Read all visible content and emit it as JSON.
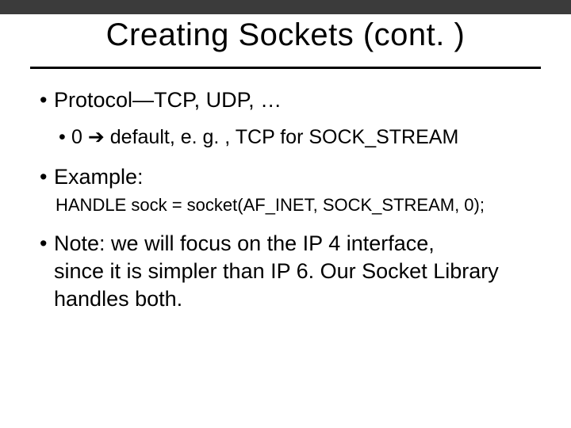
{
  "title": "Creating Sockets (cont. )",
  "bullets": {
    "protocol": "Protocol—TCP, UDP, …",
    "protocol_sub_zero": "0",
    "protocol_sub_arrow": "➔",
    "protocol_sub_text": " default, e. g. , TCP for SOCK_STREAM",
    "example": "Example:",
    "example_code": "HANDLE sock = socket(AF_INET, SOCK_STREAM, 0);",
    "note_label": "Note:",
    "note_text_first": " we will focus on the IP 4 interface,",
    "note_text_rest": "since it is simpler than IP 6. Our Socket Library handles both."
  }
}
